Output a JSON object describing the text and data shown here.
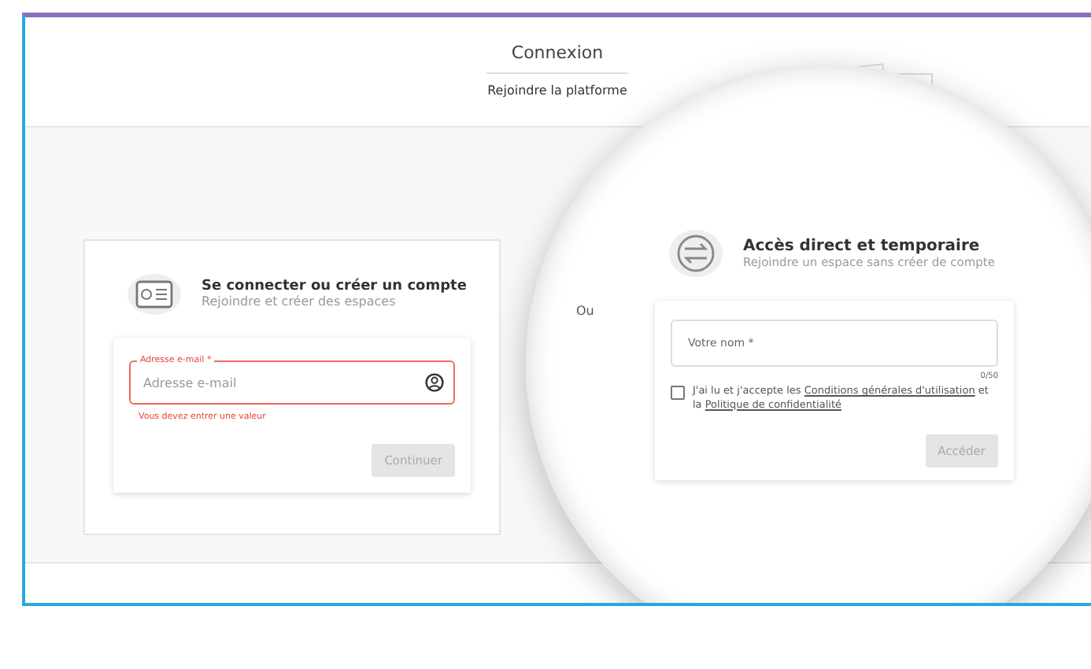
{
  "header": {
    "title": "Connexion",
    "subtitle": "Rejoindre la platforme"
  },
  "login": {
    "title": "Se connecter ou créer un compte",
    "subtitle": "Rejoindre et créer des espaces",
    "email": {
      "label": "Adresse e-mail *",
      "placeholder": "Adresse e-mail",
      "error": "Vous devez entrer une valeur"
    },
    "button": {
      "label": "Continuer",
      "disabled": true
    }
  },
  "separator": "Ou",
  "guest": {
    "title": "Accès direct et temporaire",
    "subtitle": "Rejoindre un espace sans créer de compte",
    "name": {
      "placeholder": "Votre nom *",
      "counter": "0/50"
    },
    "terms": {
      "checked": false,
      "text_before": "J'ai lu et j'accepte les ",
      "link1": "Conditions générales d'utilisation",
      "text_middle": " et la ",
      "link2": "Politique de confidentialité"
    },
    "button": {
      "label": "Accéder",
      "disabled": true
    }
  }
}
